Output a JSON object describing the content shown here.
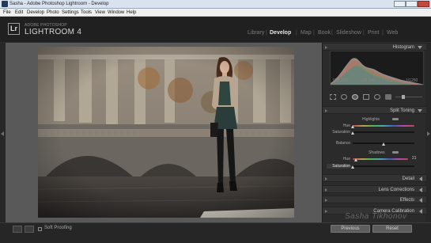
{
  "window": {
    "title": "Sasha - Adobe Photoshop Lightroom - Develop"
  },
  "menu": [
    "File",
    "Edit",
    "Develop",
    "Photo",
    "Settings",
    "Tools",
    "View",
    "Window",
    "Help"
  ],
  "identity": {
    "logo": "Lr",
    "small": "ADOBE PHOTOSHOP",
    "big": "LIGHTROOM 4"
  },
  "modules": {
    "library": "Library",
    "develop": "Develop",
    "map": "Map",
    "book": "Book",
    "slideshow": "Slideshow",
    "print": "Print",
    "web": "Web",
    "active": "Develop"
  },
  "histogram": {
    "title": "Histogram",
    "iso": "ISO 200",
    "focal": "135 mm",
    "aperture": "f / 2.2",
    "shutter": "1/1250"
  },
  "split_toning": {
    "title": "Split Toning",
    "highlights": {
      "label": "Highlights",
      "hue_label": "Hue",
      "saturation_label": "Saturation",
      "hue": 0,
      "saturation": 0
    },
    "balance": {
      "label": "Balance",
      "value": 0
    },
    "shadows": {
      "label": "Shadows",
      "hue_label": "Hue",
      "saturation_label": "Saturation",
      "hue": 21,
      "hue_text": "21",
      "saturation": 0
    }
  },
  "panels": {
    "detail": "Detail",
    "lens": "Lens Corrections",
    "effects": "Effects",
    "calibration": "Camera Calibration"
  },
  "toolbar": {
    "soft_proofing": "Soft Proofing",
    "previous": "Previous",
    "reset": "Reset"
  },
  "watermark": "Sasha Tikhonov",
  "colors": {
    "accent": "#e6e6e6",
    "panel_bg": "#2b2b2b",
    "canvas_bg": "#595959"
  }
}
